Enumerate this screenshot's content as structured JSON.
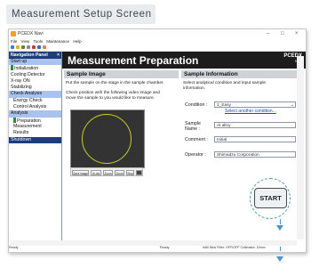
{
  "caption": "Measurement Setup Screen",
  "window": {
    "title": "PCEDX Navi",
    "controls": {
      "minimize": "–",
      "maximize": "□",
      "close": "×"
    }
  },
  "menu": [
    "File",
    "View",
    "Tools",
    "Maintenance",
    "Help"
  ],
  "nav": {
    "title": "Navigation Panel",
    "pin": "×",
    "items": [
      {
        "label": "Start up",
        "kind": "category"
      },
      {
        "label": "Initialization",
        "kind": "item",
        "marker": true
      },
      {
        "label": "Cooling Detector",
        "kind": "item"
      },
      {
        "label": "X-ray ON",
        "kind": "item"
      },
      {
        "label": "Stabilizing",
        "kind": "item"
      },
      {
        "label": "Check Analysis",
        "kind": "category"
      },
      {
        "label": "Energy Check",
        "kind": "sub"
      },
      {
        "label": "Control Analysis",
        "kind": "sub"
      },
      {
        "label": "Analysis",
        "kind": "category"
      },
      {
        "label": "Preparation",
        "kind": "sub",
        "marker": true
      },
      {
        "label": "Measurement",
        "kind": "sub"
      },
      {
        "label": "Results",
        "kind": "sub"
      },
      {
        "label": "Shutdown",
        "kind": "active"
      }
    ]
  },
  "header": {
    "title": "Measurement Preparation",
    "brand": "PCEDX",
    "brand_sub": "Navi"
  },
  "sample_image": {
    "heading": "Sample Image",
    "line1": "Put the sample on the stage in the sample chamber.",
    "line2": "Check position with the following video image and",
    "line3": "move the sample to you would like to measure.",
    "buttons": [
      "Save image",
      "Hi-res",
      "Zoom",
      "Zoom",
      "Stop"
    ],
    "camera_icon": "camera-icon"
  },
  "sample_info": {
    "heading": "Sample Information",
    "desc1": "Select analytical condition and input sample",
    "desc2": "information.",
    "condition_label": "Condition :",
    "condition_value": "2_Easy",
    "select_link": "Select another condition...",
    "sample_name_label": "Sample Name :",
    "sample_name_value": "Al alloy",
    "comment_label": "Comment :",
    "comment_value": "Initial",
    "operator_label": "Operator :",
    "operator_value": "Shimadzu Corporation"
  },
  "start_button": "START",
  "status": {
    "left": "Ready",
    "middle": "Ready",
    "right": "NAV  Blnk  Filter: OFF/OFF  Collimator: 10mm"
  },
  "colors": {
    "nav_header": "#1f3c7a",
    "nav_highlight": "#a9c2ee",
    "header_bg": "#1c1c1c",
    "accent": "#4a95c8",
    "marker": "#2e8b3a"
  }
}
